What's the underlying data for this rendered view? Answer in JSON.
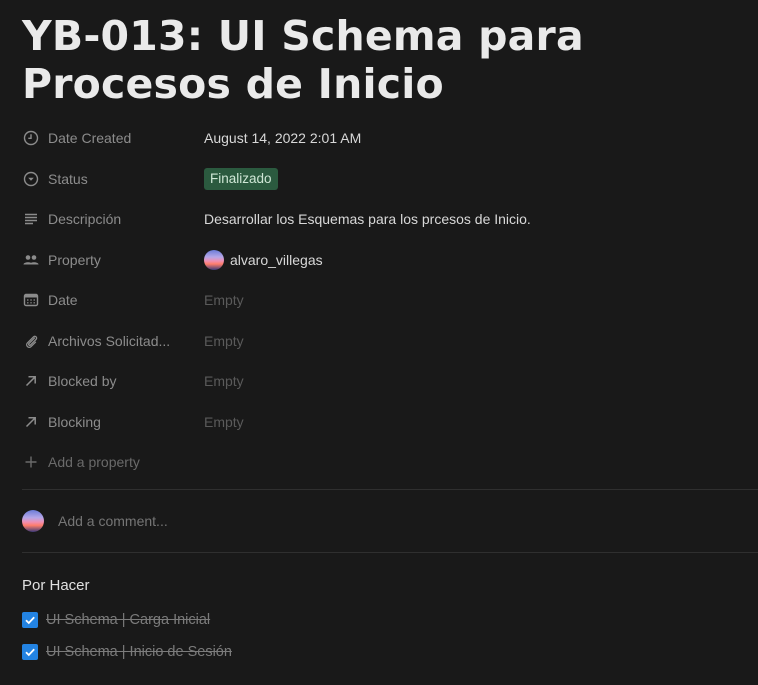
{
  "page": {
    "title": "YB-013: UI Schema para Procesos de Inicio"
  },
  "properties": [
    {
      "key": "Date Created",
      "icon": "clock-icon",
      "value": "August 14, 2022 2:01 AM",
      "type": "text"
    },
    {
      "key": "Status",
      "icon": "status-circle-icon",
      "value": "Finalizado",
      "type": "status",
      "color": "#2b5a3f"
    },
    {
      "key": "Descripción",
      "icon": "text-lines-icon",
      "value": "Desarrollar los Esquemas para los prcesos de Inicio.",
      "type": "text"
    },
    {
      "key": "Property",
      "icon": "people-icon",
      "value": "alvaro_villegas",
      "type": "person"
    },
    {
      "key": "Date",
      "icon": "calendar-icon",
      "value": "Empty",
      "type": "empty"
    },
    {
      "key": "Archivos Solicitad...",
      "icon": "paperclip-icon",
      "value": "Empty",
      "type": "empty"
    },
    {
      "key": "Blocked by",
      "icon": "relation-arrow-icon",
      "value": "Empty",
      "type": "empty"
    },
    {
      "key": "Blocking",
      "icon": "relation-arrow-icon",
      "value": "Empty",
      "type": "empty"
    }
  ],
  "add_property_label": "Add a property",
  "comment": {
    "placeholder": "Add a comment..."
  },
  "todo_section": {
    "title": "Por Hacer",
    "items": [
      {
        "label": "UI Schema | Carga Inicial",
        "checked": true
      },
      {
        "label": "UI Schema | Inicio de Sesión",
        "checked": true
      }
    ]
  },
  "colors": {
    "background": "#191919",
    "status_pill": "#2b5a3f",
    "checkbox": "#2383e2"
  }
}
